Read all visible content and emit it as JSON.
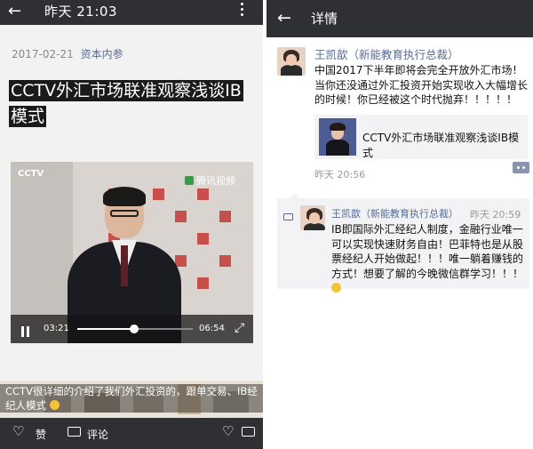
{
  "left": {
    "topbar": {
      "back_icon": "arrow-left-icon",
      "title": "昨天 21:03",
      "more_icon": "more-vertical-icon"
    },
    "article": {
      "date": "2017-02-21",
      "account": "资本内参",
      "headline": "CCTV外汇市场联准观察浅谈IB模式"
    },
    "video": {
      "channel_logo": "CCTV",
      "watermark": "腾讯视频",
      "current_time": "03:21",
      "duration": "06:54",
      "progress": 0.49,
      "pause_icon": "pause-icon",
      "fullscreen_icon": "fullscreen-icon"
    },
    "caption": "CCTV很详细的介绍了我们外汇投资的，跟单交易、IB经纪人模式",
    "bottombar": {
      "like_label": "赞",
      "comment_label": "评论"
    }
  },
  "right": {
    "topbar": {
      "back_icon": "arrow-left-icon",
      "title": "详情"
    },
    "post": {
      "author": "王凯歆（新能教育执行总裁）",
      "text": "中国2017下半年即将会完全开放外汇市场！当你还没通过外汇投资开始实现收入大幅增长的时候！你已经被这个时代抛弃！！！！！",
      "link_title": "CCTV外汇市场联准观察浅谈IB模式",
      "time": "昨天 20:56"
    },
    "comment": {
      "author": "王凯歆（新能教育执行总裁）",
      "time": "昨天 20:59",
      "text": "IB即国际外汇经纪人制度，金融行业唯一可以实现快速财务自由！巴菲特也是从股票经纪人开始做起！！！唯一躺着赚钱的方式！想要了解的今晚微信群学习！！！"
    }
  },
  "colors": {
    "topbar": "#2f3033",
    "link_blue": "#576b95"
  }
}
